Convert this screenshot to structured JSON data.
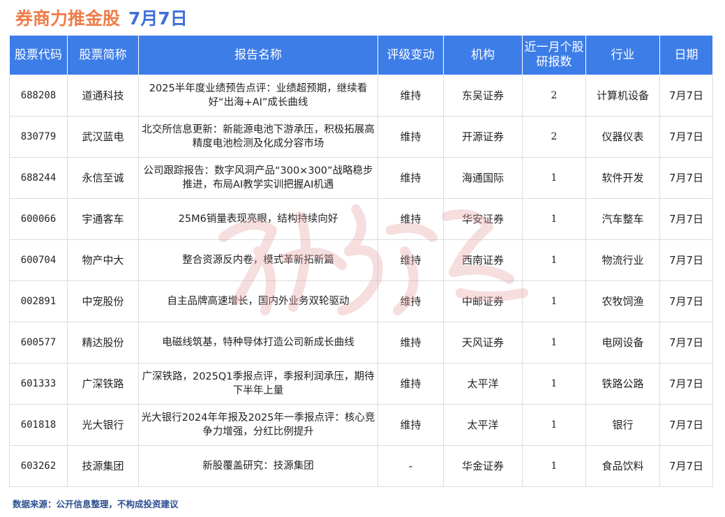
{
  "title": {
    "main": "券商力推金股",
    "date": "7月7日"
  },
  "table": {
    "headers": [
      "股票代码",
      "股票简称",
      "报告名称",
      "评级变动",
      "机构",
      "近一月个股研报数",
      "行业",
      "日期"
    ],
    "rows": [
      {
        "code": "688208",
        "name": "道通科技",
        "report": "2025半年度业绩预告点评：业绩超预期，继续看好“出海+AI”成长曲线",
        "rating": "维持",
        "broker": "东吴证券",
        "count": "2",
        "industry": "计算机设备",
        "date": "7月7日"
      },
      {
        "code": "830779",
        "name": "武汉蓝电",
        "report": "北交所信息更新：新能源电池下游承压，积极拓展高精度电池检测及化成分容市场",
        "rating": "维持",
        "broker": "开源证券",
        "count": "2",
        "industry": "仪器仪表",
        "date": "7月7日"
      },
      {
        "code": "688244",
        "name": "永信至诚",
        "report": "公司跟踪报告：数字风洞产品“300×300”战略稳步推进，布局AI教学实训把握AI机遇",
        "rating": "维持",
        "broker": "海通国际",
        "count": "1",
        "industry": "软件开发",
        "date": "7月7日"
      },
      {
        "code": "600066",
        "name": "宇通客车",
        "report": "25M6销量表现亮眼，结构持续向好",
        "rating": "维持",
        "broker": "华安证券",
        "count": "1",
        "industry": "汽车整车",
        "date": "7月7日"
      },
      {
        "code": "600704",
        "name": "物产中大",
        "report": "整合资源反内卷，模式革新拓新篇",
        "rating": "维持",
        "broker": "西南证券",
        "count": "1",
        "industry": "物流行业",
        "date": "7月7日"
      },
      {
        "code": "002891",
        "name": "中宠股份",
        "report": "自主品牌高速增长，国内外业务双轮驱动",
        "rating": "维持",
        "broker": "中邮证券",
        "count": "1",
        "industry": "农牧饲渔",
        "date": "7月7日"
      },
      {
        "code": "600577",
        "name": "精达股份",
        "report": "电磁线筑基，特种导体打造公司新成长曲线",
        "rating": "维持",
        "broker": "天风证券",
        "count": "1",
        "industry": "电网设备",
        "date": "7月7日"
      },
      {
        "code": "601333",
        "name": "广深铁路",
        "report": "广深铁路，2025Q1季报点评，季报利润承压，期待下半年上量",
        "rating": "维持",
        "broker": "太平洋",
        "count": "1",
        "industry": "铁路公路",
        "date": "7月7日"
      },
      {
        "code": "601818",
        "name": "光大银行",
        "report": "光大银行2024年年报及2025年一季报点评：核心竞争力增强，分红比例提升",
        "rating": "维持",
        "broker": "太平洋",
        "count": "1",
        "industry": "银行",
        "date": "7月7日"
      },
      {
        "code": "603262",
        "name": "技源集团",
        "report": "新股覆盖研究：技源集团",
        "rating": "-",
        "broker": "华金证券",
        "count": "1",
        "industry": "食品饮料",
        "date": "7月7日"
      }
    ]
  },
  "footer": "数据来源：公开信息整理，不构成投资建议",
  "colors": {
    "header_bg": "#3d7de7",
    "title_orange": "#ef7d4a",
    "title_blue": "#3f6fd6",
    "watermark": "#e8a3a3"
  }
}
